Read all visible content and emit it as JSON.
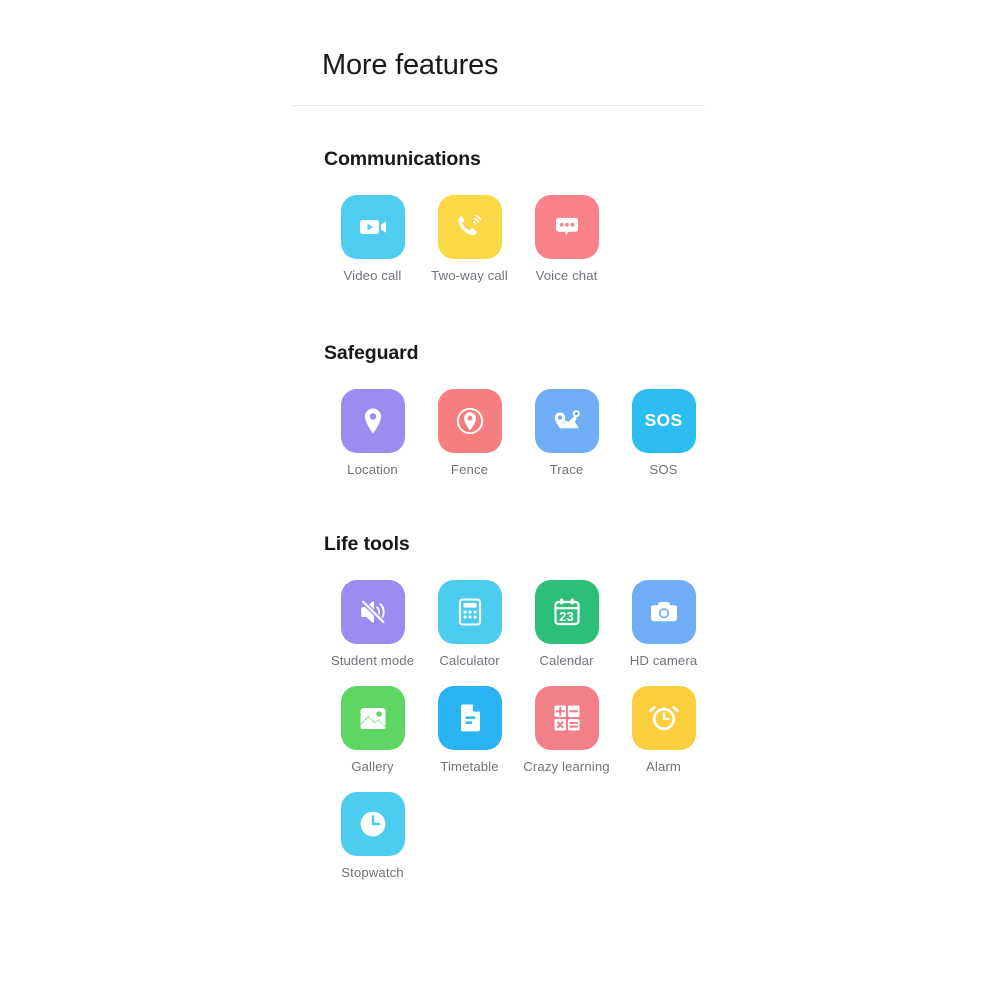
{
  "header": {
    "title": "More features"
  },
  "sections": [
    {
      "id": "communications",
      "title": "Communications",
      "items": [
        {
          "label": "Video call",
          "icon": "video-camera-icon",
          "color": "#4ECDF0"
        },
        {
          "label": "Two-way call",
          "icon": "phone-ringing-icon",
          "color": "#FBD845"
        },
        {
          "label": "Voice chat",
          "icon": "chat-bubble-icon",
          "color": "#F98189"
        }
      ]
    },
    {
      "id": "safeguard",
      "title": "Safeguard",
      "items": [
        {
          "label": "Location",
          "icon": "map-pin-icon",
          "color": "#9B8DF0"
        },
        {
          "label": "Fence",
          "icon": "geofence-icon",
          "color": "#F57F80"
        },
        {
          "label": "Trace",
          "icon": "route-trace-icon",
          "color": "#6FAEF4"
        },
        {
          "label": "SOS",
          "icon": "sos-icon",
          "color": "#2CBEEF",
          "glyph": "SOS"
        }
      ]
    },
    {
      "id": "life-tools",
      "title": "Life tools",
      "items": [
        {
          "label": "Student mode",
          "icon": "speaker-mute-icon",
          "color": "#9B8DF0"
        },
        {
          "label": "Calculator",
          "icon": "calculator-icon",
          "color": "#4CCDF0"
        },
        {
          "label": "Calendar",
          "icon": "calendar-icon",
          "color": "#2BBF78",
          "glyph": "23"
        },
        {
          "label": "HD camera",
          "icon": "camera-icon",
          "color": "#6FAEF4"
        },
        {
          "label": "Gallery",
          "icon": "photo-image-icon",
          "color": "#5DD662"
        },
        {
          "label": "Timetable",
          "icon": "document-icon",
          "color": "#29B3F2"
        },
        {
          "label": "Crazy learning",
          "icon": "math-operators-icon",
          "color": "#F28089"
        },
        {
          "label": "Alarm",
          "icon": "alarm-clock-icon",
          "color": "#FBCE3E"
        },
        {
          "label": "Stopwatch",
          "icon": "stopwatch-icon",
          "color": "#4CCDF0"
        }
      ]
    }
  ]
}
